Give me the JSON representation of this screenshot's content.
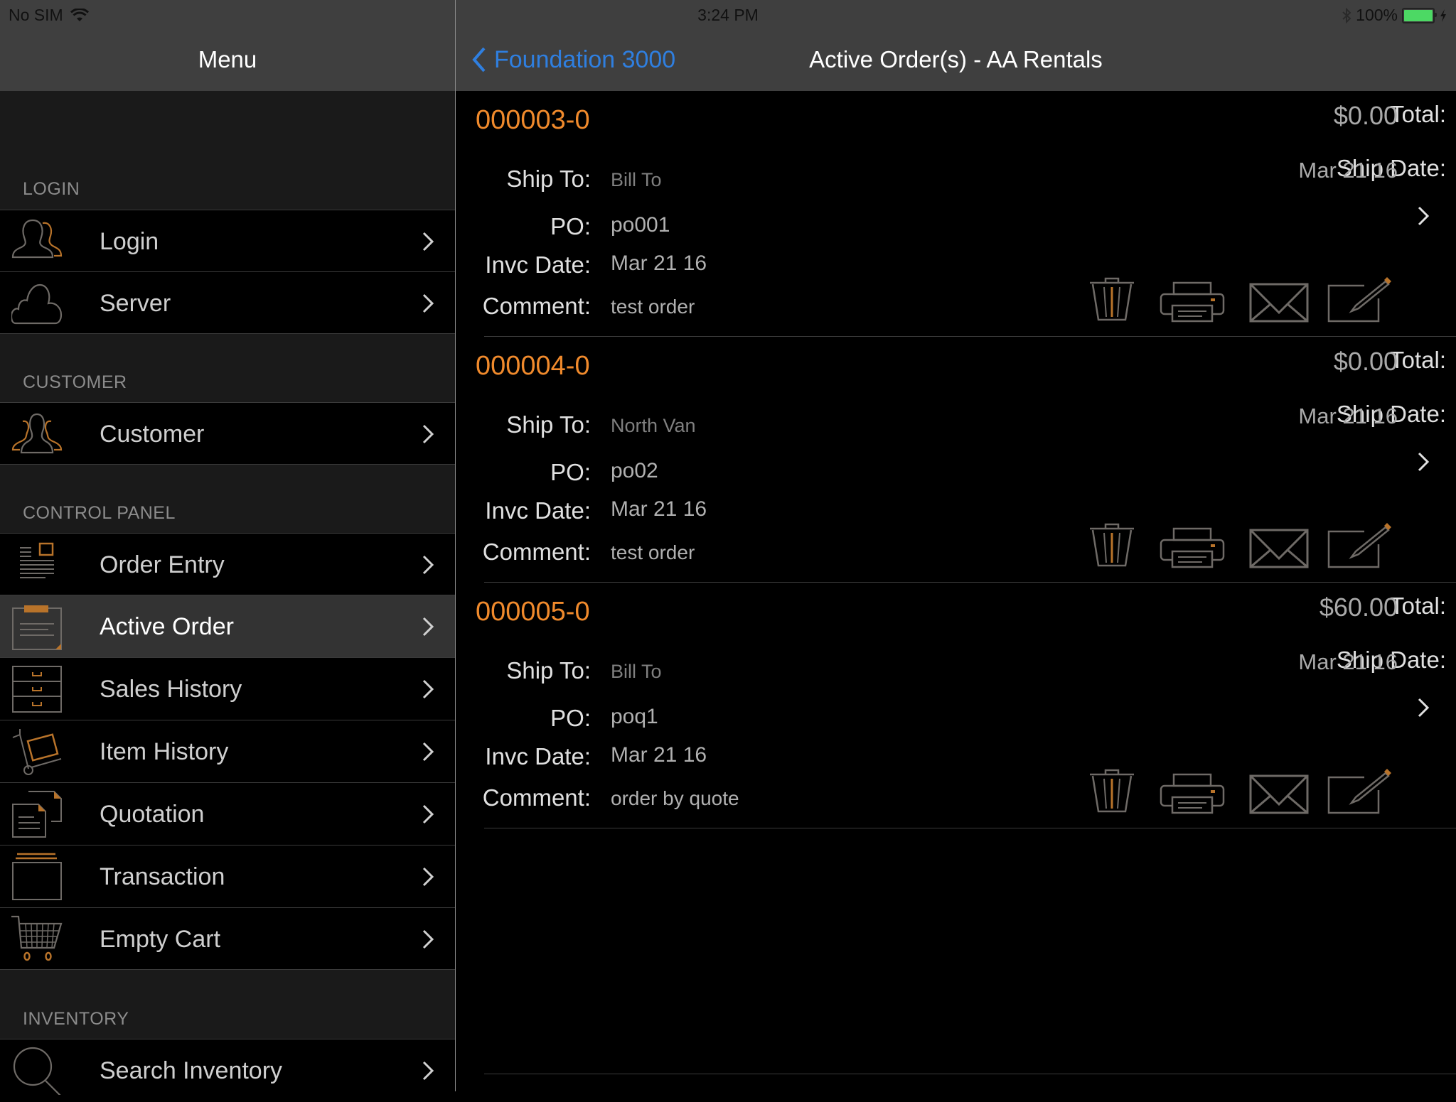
{
  "status_bar": {
    "carrier": "No SIM",
    "time": "3:24 PM",
    "battery_percent": "100%",
    "battery_level": 1.0,
    "battery_color": "#4cd964"
  },
  "sidebar": {
    "title": "Menu",
    "sections": [
      {
        "header": "LOGIN",
        "items": [
          {
            "label": "Login",
            "icon": "users-icon"
          },
          {
            "label": "Server",
            "icon": "cloud-icon"
          }
        ]
      },
      {
        "header": "CUSTOMER",
        "items": [
          {
            "label": "Customer",
            "icon": "customers-group-icon"
          }
        ]
      },
      {
        "header": "CONTROL PANEL",
        "items": [
          {
            "label": "Order Entry",
            "icon": "order-form-icon"
          },
          {
            "label": "Active Order",
            "icon": "clipboard-icon",
            "selected": true
          },
          {
            "label": "Sales History",
            "icon": "filing-cabinet-icon"
          },
          {
            "label": "Item History",
            "icon": "hand-truck-icon"
          },
          {
            "label": "Quotation",
            "icon": "documents-icon"
          },
          {
            "label": "Transaction",
            "icon": "tray-icon"
          },
          {
            "label": "Empty Cart",
            "icon": "cart-icon"
          }
        ]
      },
      {
        "header": "INVENTORY",
        "items": [
          {
            "label": "Search Inventory",
            "icon": "search-icon"
          }
        ]
      }
    ]
  },
  "navbar": {
    "back_label": "Foundation 3000",
    "title": "Active Order(s) - AA Rentals"
  },
  "labels": {
    "ship_to": "Ship To:",
    "po": "PO:",
    "invc_date": "Invc Date:",
    "comment": "Comment:",
    "total": "Total:",
    "ship_date": "Ship Date:"
  },
  "orders": [
    {
      "number": "000003-0",
      "ship_to": "Bill To",
      "po": "po001",
      "invc_date": "Mar 21 16",
      "comment": "test order",
      "total": "$0.00",
      "ship_date": "Mar 21 16"
    },
    {
      "number": "000004-0",
      "ship_to": "North Van",
      "po": "po02",
      "invc_date": "Mar 21 16",
      "comment": "test order",
      "total": "$0.00",
      "ship_date": "Mar 21 16"
    },
    {
      "number": "000005-0",
      "ship_to": "Bill To",
      "po": "poq1",
      "invc_date": "Mar 21 16",
      "comment": "order by quote",
      "total": "$60.00",
      "ship_date": "Mar 21 16"
    }
  ],
  "order_actions": [
    "trash-icon",
    "printer-icon",
    "mail-icon",
    "edit-icon"
  ],
  "colors": {
    "accent_orange": "#f08a2c",
    "icon_orange": "#b8732a",
    "link_blue": "#2f7fe0",
    "icon_gray": "#6e6a66"
  }
}
